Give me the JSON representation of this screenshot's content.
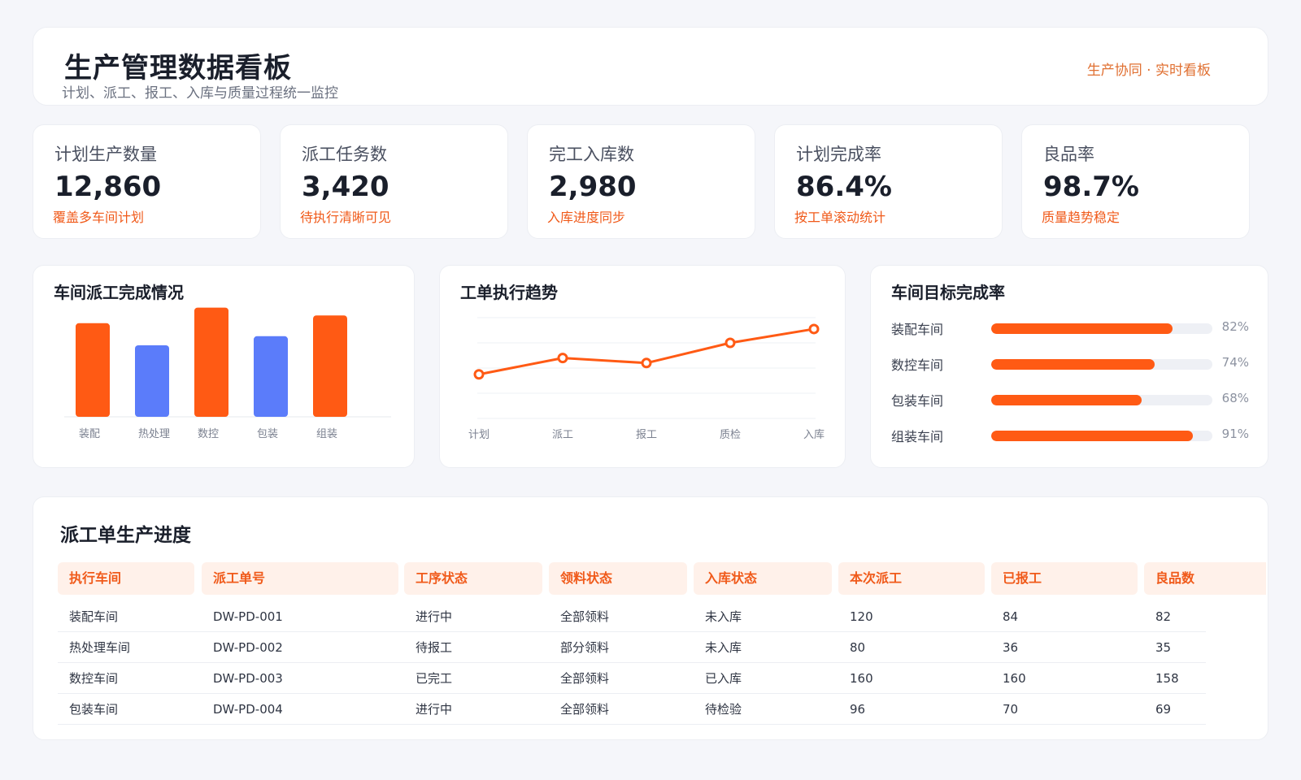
{
  "header": {
    "title": "生产管理数据看板",
    "subtitle": "计划、派工、报工、入库与质量过程统一监控",
    "badge": "生产协同 · 实时看板"
  },
  "kpis": [
    {
      "label": "计划生产数量",
      "value": "12,860",
      "note": "覆盖多车间计划"
    },
    {
      "label": "派工任务数",
      "value": "3,420",
      "note": "待执行清晰可见"
    },
    {
      "label": "完工入库数",
      "value": "2,980",
      "note": "入库进度同步"
    },
    {
      "label": "计划完成率",
      "value": "86.4%",
      "note": "按工单滚动统计"
    },
    {
      "label": "良品率",
      "value": "98.7%",
      "note": "质量趋势稳定"
    }
  ],
  "colors": {
    "accent": "#ff5a14",
    "secondary": "#5b7cfa",
    "accent_text": "#f05a1a"
  },
  "bar_panel": {
    "title": "车间派工完成情况"
  },
  "line_panel": {
    "title": "工单执行趋势"
  },
  "progress_panel": {
    "title": "车间目标完成率",
    "items": [
      {
        "name": "装配车间",
        "value": 82,
        "label": "82%"
      },
      {
        "name": "数控车间",
        "value": 74,
        "label": "74%"
      },
      {
        "name": "包装车间",
        "value": 68,
        "label": "68%"
      },
      {
        "name": "组装车间",
        "value": 91,
        "label": "91%"
      }
    ]
  },
  "chart_data": [
    {
      "type": "bar",
      "title": "车间派工完成情况",
      "categories": [
        "装配",
        "热处理",
        "数控",
        "包装",
        "组装"
      ],
      "values": [
        72,
        55,
        84,
        62,
        78
      ],
      "bar_colors": [
        "#ff5a14",
        "#5b7cfa",
        "#ff5a14",
        "#5b7cfa",
        "#ff5a14"
      ],
      "ylim": [
        0,
        90
      ],
      "grid": false
    },
    {
      "type": "line",
      "title": "工单执行趋势",
      "categories": [
        "计划",
        "派工",
        "报工",
        "质检",
        "入库"
      ],
      "values": [
        55,
        68,
        64,
        80,
        91
      ],
      "ylim": [
        20,
        100
      ],
      "grid": true
    }
  ],
  "table": {
    "title": "派工单生产进度",
    "columns": [
      "执行车间",
      "派工单号",
      "工序状态",
      "领料状态",
      "入库状态",
      "本次派工",
      "已报工",
      "良品数"
    ],
    "rows": [
      [
        "装配车间",
        "DW-PD-001",
        "进行中",
        "全部领料",
        "未入库",
        "120",
        "84",
        "82"
      ],
      [
        "热处理车间",
        "DW-PD-002",
        "待报工",
        "部分领料",
        "未入库",
        "80",
        "36",
        "35"
      ],
      [
        "数控车间",
        "DW-PD-003",
        "已完工",
        "全部领料",
        "已入库",
        "160",
        "160",
        "158"
      ],
      [
        "包装车间",
        "DW-PD-004",
        "进行中",
        "全部领料",
        "待检验",
        "96",
        "70",
        "69"
      ]
    ]
  }
}
